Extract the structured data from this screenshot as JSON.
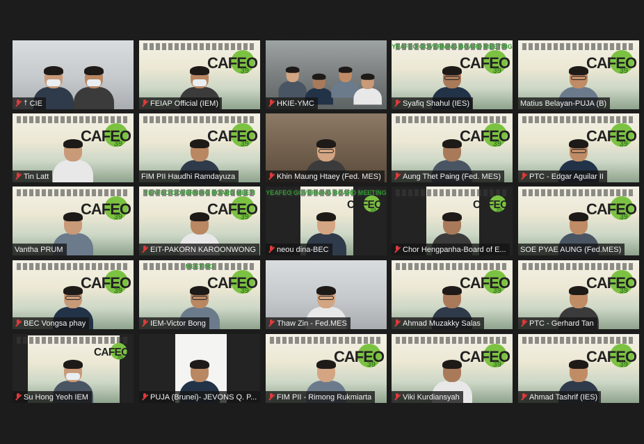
{
  "meeting": {
    "participants": [
      {
        "name": "CIE",
        "bg": "room",
        "pinned": true,
        "muted": true,
        "people": 2,
        "masked": true
      },
      {
        "name": "FEIAP Official (IEM)",
        "bg": "cafeo",
        "muted": true,
        "people": 1,
        "masked": true
      },
      {
        "name": "HKIE-YMC",
        "bg": "room2",
        "muted": true,
        "people": 4
      },
      {
        "name": "Syafiq Shahul (IES)",
        "bg": "cafeo",
        "muted": true,
        "people": 1,
        "banner": "YEAFEO GOVERNING BOARD MEETING",
        "glasses": true
      },
      {
        "name": "Matius Belayan-PUJA (B)",
        "bg": "cafeo",
        "muted": false,
        "people": 1,
        "active": true,
        "glasses": true
      },
      {
        "name": "Tin Latt",
        "bg": "cafeo",
        "muted": true,
        "people": 1
      },
      {
        "name": "FIM PII Haudhi Ramdayuza",
        "bg": "cafeo",
        "muted": false,
        "people": 1
      },
      {
        "name": "Khin Maung Htaey (Fed. MES)",
        "bg": "wood",
        "muted": true,
        "people": 1,
        "glasses": true
      },
      {
        "name": "Aung Thet Paing (Fed. MES)",
        "bg": "cafeo",
        "muted": true,
        "people": 1
      },
      {
        "name": "PTC - Edgar Aguilar II",
        "bg": "cafeo",
        "muted": true,
        "people": 1,
        "glasses": true
      },
      {
        "name": "Vantha PRUM",
        "bg": "cafeo",
        "muted": false,
        "people": 1
      },
      {
        "name": "EIT-PAKORN KAROONWONG",
        "bg": "cafeo",
        "muted": true,
        "people": 1,
        "banner": "YEAFEO GOVERNING BOARD MEETI"
      },
      {
        "name": "neou dina-BEC",
        "bg": "dark",
        "muted": true,
        "people": 1,
        "narrow": true,
        "banner": "YEAFEO GOVERNING BOARD MEETING"
      },
      {
        "name": "Chor Hengpanha-Board of E...",
        "bg": "dark",
        "muted": true,
        "people": 1,
        "narrow": true
      },
      {
        "name": "SOE PYAE AUNG (Fed.MES)",
        "bg": "cafeo",
        "muted": false,
        "people": 1
      },
      {
        "name": "BEC Vongsa phay",
        "bg": "cafeo",
        "muted": true,
        "people": 1,
        "glasses": true
      },
      {
        "name": "IEM-Victor Bong",
        "bg": "cafeo",
        "muted": true,
        "people": 1,
        "banner": "MEETING",
        "glasses": true
      },
      {
        "name": "Thaw Zin - Fed.MES",
        "bg": "room",
        "muted": true,
        "people": 1,
        "glasses": true
      },
      {
        "name": "Ahmad Muzakky Salas",
        "bg": "cafeo",
        "muted": true,
        "people": 1
      },
      {
        "name": "PTC - Gerhard Tan",
        "bg": "cafeo",
        "muted": true,
        "people": 1
      },
      {
        "name": "Su Hong Yeoh IEM",
        "bg": "dark",
        "muted": true,
        "people": 1,
        "narrow": true,
        "masked": true
      },
      {
        "name": "PUJA (Brunei)- JEVONS Q. P...",
        "bg": "dark",
        "muted": true,
        "people": 1,
        "narrow": true,
        "white": true
      },
      {
        "name": "FIM PII - Rimong Rukmiarta",
        "bg": "cafeo",
        "muted": true,
        "people": 1
      },
      {
        "name": "Viki Kurdiansyah",
        "bg": "cafeo",
        "muted": true,
        "people": 1
      },
      {
        "name": "Ahmad Tashrif (IES)",
        "bg": "cafeo",
        "muted": true,
        "people": 1
      }
    ]
  },
  "branding": {
    "cafeo_text": "CAFEO",
    "cafeo_num": "39",
    "puja_text": "PUJA"
  },
  "colors": {
    "active_outline": "#d4e64a",
    "muted_icon": "#e03a3a",
    "background": "#1c1c1c"
  }
}
